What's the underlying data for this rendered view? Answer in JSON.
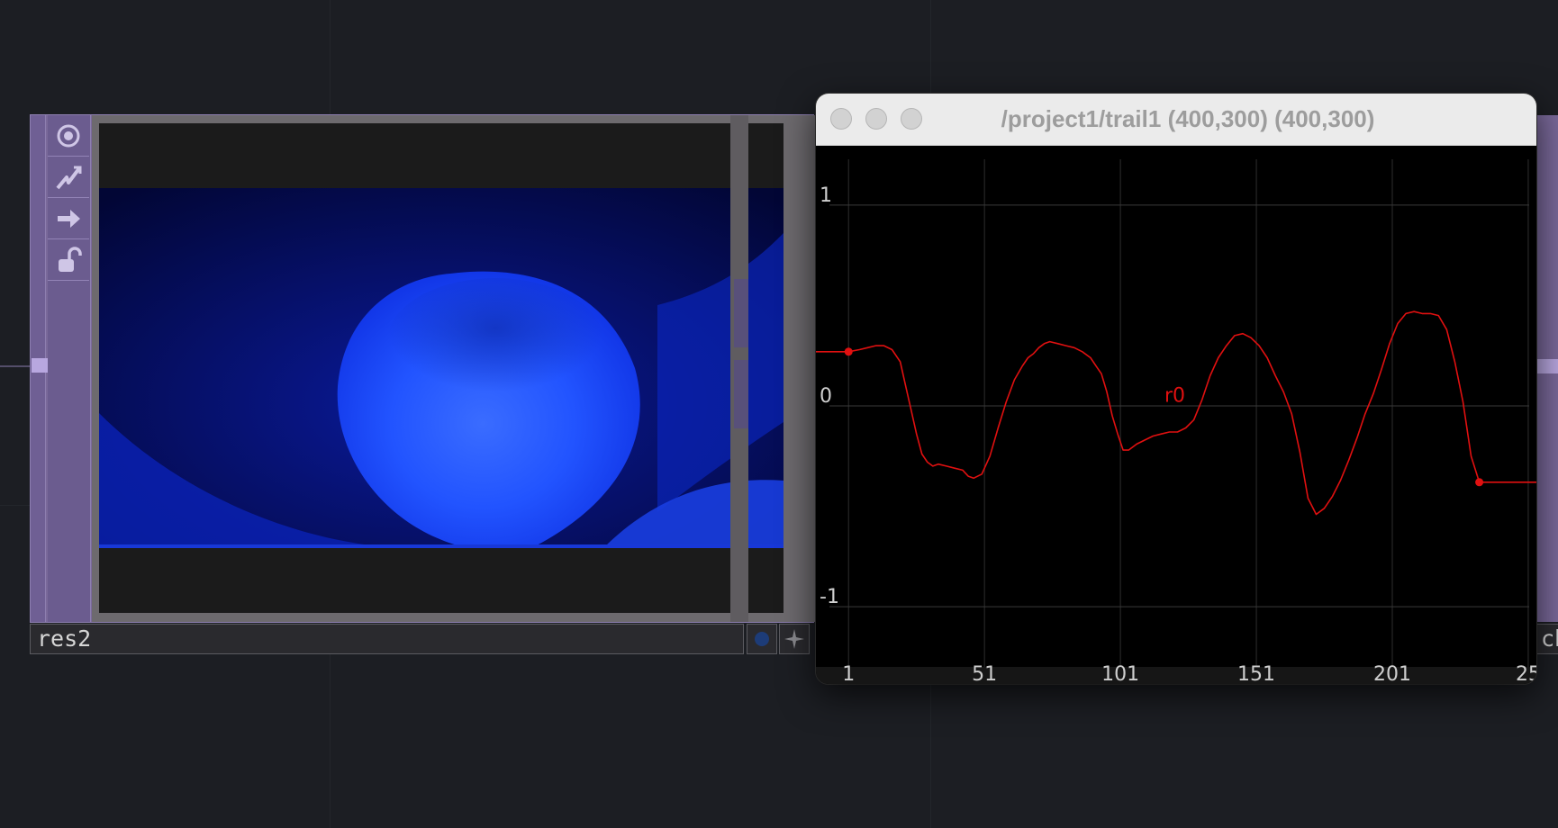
{
  "node": {
    "name": "res2",
    "toolbar_icons": [
      "viewer-icon",
      "bypass-icon",
      "export-arrow-icon",
      "lock-icon"
    ]
  },
  "right_node": {
    "name_visible": "ch"
  },
  "window": {
    "title": "/project1/trail1 (400,300) (400,300)",
    "buttons": [
      "close",
      "minimize",
      "zoom"
    ]
  },
  "chart_data": {
    "type": "line",
    "title": "",
    "xlabel": "",
    "ylabel": "",
    "x_ticks": [
      "1",
      "51",
      "101",
      "151",
      "201",
      "25"
    ],
    "y_ticks": [
      "1",
      "0",
      "-1"
    ],
    "xlim": [
      -11,
      254
    ],
    "ylim": [
      -1.3,
      1.3
    ],
    "grid": true,
    "series": [
      {
        "name": "r0",
        "color": "#e01010",
        "x": [
          1,
          5,
          8,
          11,
          14,
          17,
          20,
          22,
          24,
          26,
          28,
          30,
          32,
          34,
          37,
          40,
          43,
          45,
          47,
          50,
          53,
          56,
          59,
          62,
          65,
          67,
          69,
          71,
          73,
          75,
          78,
          81,
          84,
          87,
          90,
          92,
          94,
          96,
          98,
          100,
          102,
          104,
          107,
          110,
          113,
          116,
          119,
          122,
          125,
          128,
          131,
          134,
          137,
          140,
          143,
          146,
          149,
          152,
          155,
          158,
          161,
          164,
          167,
          170,
          173,
          176,
          179,
          182,
          185,
          188,
          191,
          194,
          197,
          200,
          203,
          206,
          209,
          212,
          215,
          218,
          221,
          224,
          227,
          230,
          233,
          236,
          239,
          242
        ],
        "y": [
          0.27,
          0.28,
          0.29,
          0.3,
          0.3,
          0.28,
          0.22,
          0.1,
          -0.02,
          -0.14,
          -0.24,
          -0.28,
          -0.3,
          -0.29,
          -0.3,
          -0.31,
          -0.32,
          -0.35,
          -0.36,
          -0.34,
          -0.25,
          -0.11,
          0.02,
          0.13,
          0.2,
          0.24,
          0.26,
          0.29,
          0.31,
          0.32,
          0.31,
          0.3,
          0.29,
          0.27,
          0.24,
          0.2,
          0.16,
          0.07,
          -0.05,
          -0.14,
          -0.22,
          -0.22,
          -0.19,
          -0.17,
          -0.15,
          -0.14,
          -0.13,
          -0.13,
          -0.11,
          -0.07,
          0.03,
          0.15,
          0.24,
          0.3,
          0.35,
          0.36,
          0.34,
          0.3,
          0.24,
          0.15,
          0.07,
          -0.04,
          -0.23,
          -0.46,
          -0.54,
          -0.51,
          -0.45,
          -0.37,
          -0.27,
          -0.16,
          -0.04,
          0.06,
          0.18,
          0.31,
          0.41,
          0.46,
          0.47,
          0.46,
          0.46,
          0.45,
          0.38,
          0.22,
          0.02,
          -0.25,
          -0.38,
          -0.38,
          -0.38,
          -0.38
        ]
      }
    ],
    "marker_points": [
      [
        1,
        0.27
      ],
      [
        233,
        -0.38
      ]
    ]
  }
}
